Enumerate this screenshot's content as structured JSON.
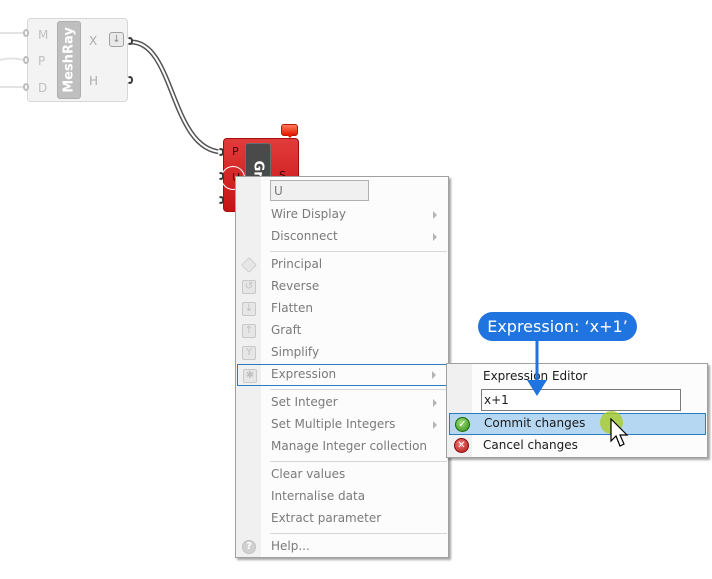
{
  "canvas": {
    "meshray": {
      "nickname": "MeshRay",
      "inputs": [
        "M",
        "P",
        "D"
      ],
      "outputs": [
        "X",
        "H"
      ],
      "flag_icon": "arrow-down-icon"
    },
    "grid": {
      "nickname": "Grid",
      "inputs": [
        "P",
        "U",
        ""
      ],
      "outputs": [
        "S"
      ],
      "color": "#d42222"
    }
  },
  "context_menu": {
    "name_field": "U",
    "groups": [
      [
        {
          "label": "Wire Display",
          "submenu": true
        },
        {
          "label": "Disconnect",
          "submenu": true
        }
      ],
      [
        {
          "label": "Principal",
          "icon": "principal-icon"
        },
        {
          "label": "Reverse",
          "icon": "reverse-icon"
        },
        {
          "label": "Flatten",
          "icon": "flatten-icon"
        },
        {
          "label": "Graft",
          "icon": "graft-icon"
        },
        {
          "label": "Simplify",
          "icon": "simplify-icon"
        },
        {
          "label": "Expression",
          "icon": "expression-icon",
          "submenu": true,
          "highlighted": true
        }
      ],
      [
        {
          "label": "Set Integer",
          "submenu": true
        },
        {
          "label": "Set Multiple Integers",
          "submenu": true
        },
        {
          "label": "Manage Integer collection"
        }
      ],
      [
        {
          "label": "Clear values"
        },
        {
          "label": "Internalise data"
        },
        {
          "label": "Extract parameter"
        }
      ],
      [
        {
          "label": "Help...",
          "icon": "help-icon"
        }
      ]
    ]
  },
  "expression_submenu": {
    "editor_label": "Expression Editor",
    "expression_value": "x+1",
    "commit_label": "Commit changes",
    "cancel_label": "Cancel changes"
  },
  "callout": {
    "text": "Expression: ‘x+1’",
    "color": "#1f74e0"
  }
}
